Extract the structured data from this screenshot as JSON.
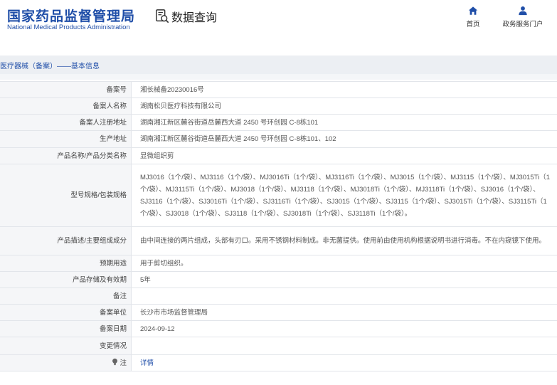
{
  "header": {
    "logo_cn": "国家药品监督管理局",
    "logo_en": "National Medical Products Administration",
    "query_title": "数据查询",
    "nav": [
      {
        "label": "首页",
        "icon": "home-icon"
      },
      {
        "label": "政务服务门户",
        "icon": "user-icon"
      }
    ]
  },
  "breadcrumb": "医疗器械（备案）——基本信息",
  "colors": {
    "brand": "#1f4ea8",
    "label_bg": "#f5f6f8",
    "border": "#e2e5ea"
  },
  "rows": [
    {
      "label": "备案号",
      "value": "湘长械备20230016号"
    },
    {
      "label": "备案人名称",
      "value": "湖南松贝医疗科技有限公司"
    },
    {
      "label": "备案人注册地址",
      "value": "湖南湘江新区麓谷街道岳麓西大道 2450 号环创园 C-8栋101"
    },
    {
      "label": "生产地址",
      "value": "湖南湘江新区麓谷街道岳麓西大道 2450 号环创园 C-8栋101、102"
    },
    {
      "label": "产品名称/产品分类名称",
      "value": "显微组织剪"
    },
    {
      "label": "型号规格/包装规格",
      "value": "MJ3016（1个/袋）、MJ3116（1个/袋）、MJ3016Ti（1个/袋）、MJ3116Ti（1个/袋）、MJ3015（1个/袋）、MJ3115（1个/袋）、MJ3015Ti（1个/袋）、MJ3115Ti（1个/袋）、MJ3018（1个/袋）、MJ3118（1个/袋）、MJ3018Ti（1个/袋）、MJ3118Ti（1个/袋）、SJ3016（1个/袋）、SJ3116（1个/袋）、SJ3016Ti（1个/袋）、SJ3116Ti（1个/袋）、SJ3015（1个/袋）、SJ3115（1个/袋）、SJ3015Ti（1个/袋）、SJ3115Ti（1个/袋）、SJ3018（1个/袋）、SJ3118（1个/袋）、SJ3018Ti（1个/袋）、SJ3118Ti（1个/袋）。"
    },
    {
      "label": "产品描述/主要组成成分",
      "value": "由中间连接的两片组成，头部有刃口。采用不锈钢材料制成。非无菌提供。使用前由使用机构根据说明书进行消毒。不在内窥镜下使用。"
    },
    {
      "label": "预期用途",
      "value": "用于剪切组织。"
    },
    {
      "label": "产品存储及有效期",
      "value": "5年"
    },
    {
      "label": "备注",
      "value": ""
    },
    {
      "label": "备案单位",
      "value": "长沙市市场监督管理局"
    },
    {
      "label": "备案日期",
      "value": "2024-09-12"
    },
    {
      "label": "变更情况",
      "value": ""
    },
    {
      "label": "注",
      "value": "详情",
      "icon": "lightbulb-icon"
    }
  ]
}
